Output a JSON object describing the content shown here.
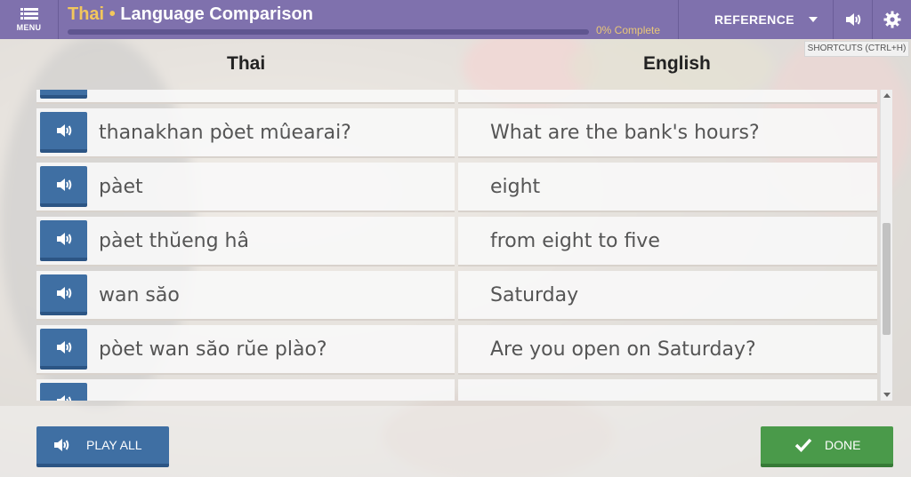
{
  "header": {
    "menu_label": "MENU",
    "language": "Thai",
    "separator": "•",
    "activity_title": "Language Comparison",
    "progress_text": "0% Complete",
    "progress_percent": 0,
    "reference_label": "REFERENCE",
    "shortcuts_tooltip": "SHORTCUTS (CTRL+H)"
  },
  "columns": {
    "left": "Thai",
    "right": "English"
  },
  "rows": [
    {
      "thai": "",
      "english": ""
    },
    {
      "thai": "thanakhan pòet mûearai?",
      "english": "What are the bank's hours?"
    },
    {
      "thai": "pàet",
      "english": "eight"
    },
    {
      "thai": "pàet thŭeng hâ",
      "english": "from eight to five"
    },
    {
      "thai": "wan săo",
      "english": "Saturday"
    },
    {
      "thai": "pòet wan săo rŭe plào?",
      "english": "Are you open on Saturday?"
    },
    {
      "thai": "",
      "english": ""
    }
  ],
  "footer": {
    "play_all_label": "PLAY ALL",
    "done_label": "DONE"
  },
  "colors": {
    "topbar": "#7f71ad",
    "accent_yellow": "#f2c75c",
    "play_blue": "#3f6fa3",
    "done_green": "#4a9a4a"
  }
}
